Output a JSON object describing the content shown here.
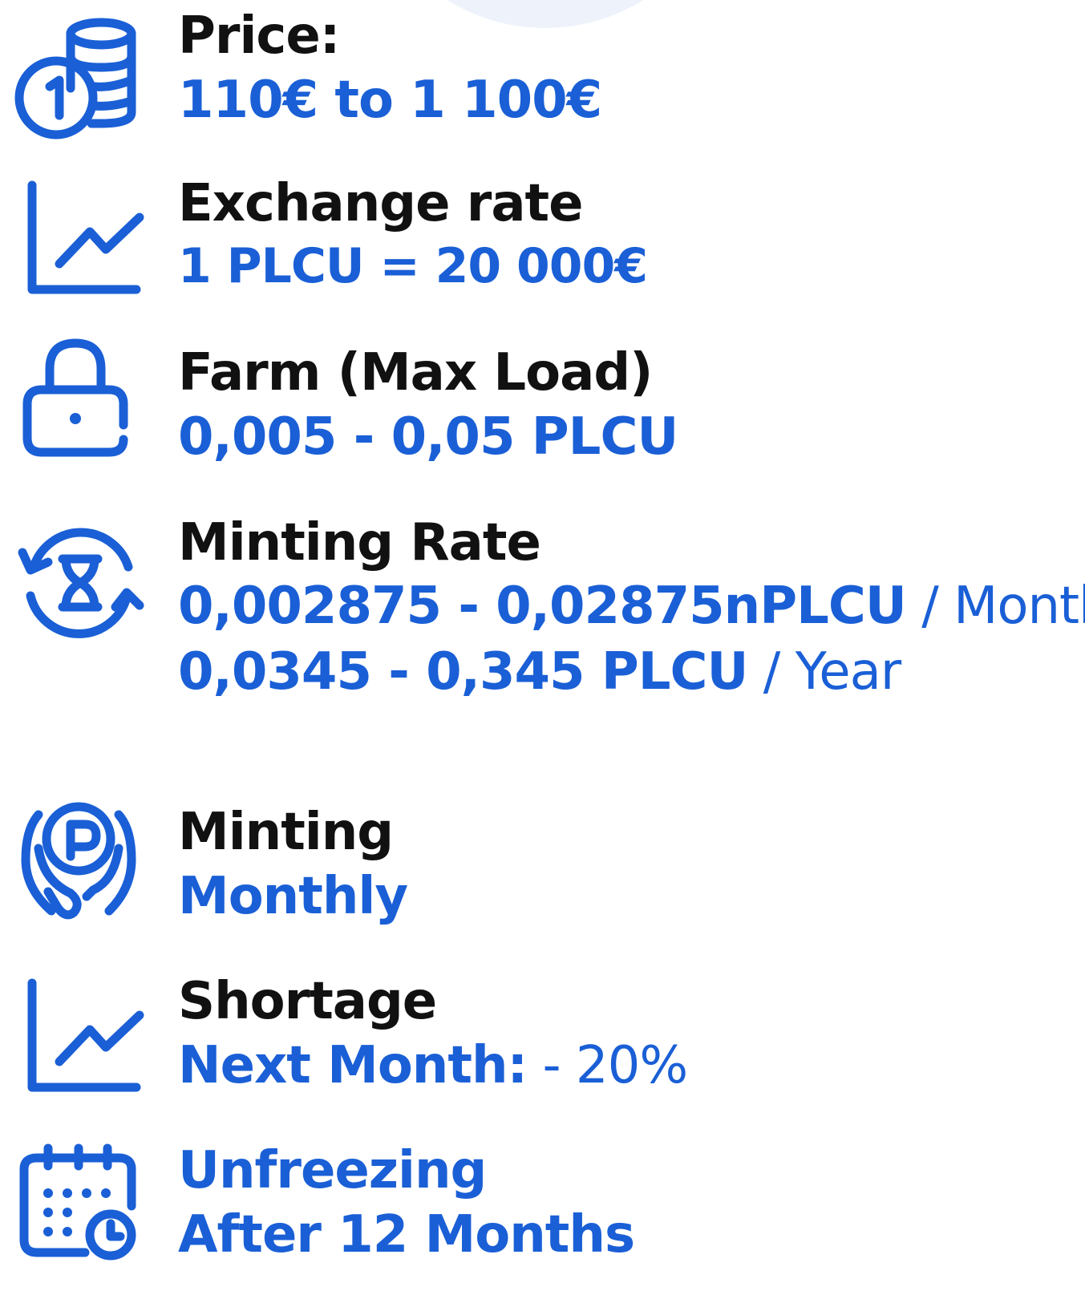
{
  "items": [
    {
      "icon": "coins-icon",
      "label": "Price:",
      "value": "110€ to 1 100€"
    },
    {
      "icon": "line-chart-icon",
      "label": "Exchange rate",
      "value": "1 PLCU = 20 000€"
    },
    {
      "icon": "lock-icon",
      "label": "Farm (Max Load)",
      "value": "0,005 - 0,05 PLCU"
    },
    {
      "icon": "hourglass-cycle-icon",
      "label": "Minting Rate",
      "value_month": "0,002875 - 0,02875nPLCU",
      "suffix_month": " / Month",
      "value_year": "0,0345 - 0,345 PLCU",
      "suffix_year": " / Year"
    },
    {
      "icon": "hands-coin-icon",
      "label": "Minting",
      "value": "Monthly"
    },
    {
      "icon": "line-chart-icon",
      "label": "Shortage",
      "value": "Next Month:",
      "value_suffix": " - 20%"
    },
    {
      "icon": "calendar-clock-icon",
      "label": "Unfreezing",
      "value": "After 12 Months"
    }
  ],
  "colors": {
    "accent": "#1a5fd6",
    "label": "#111111"
  }
}
